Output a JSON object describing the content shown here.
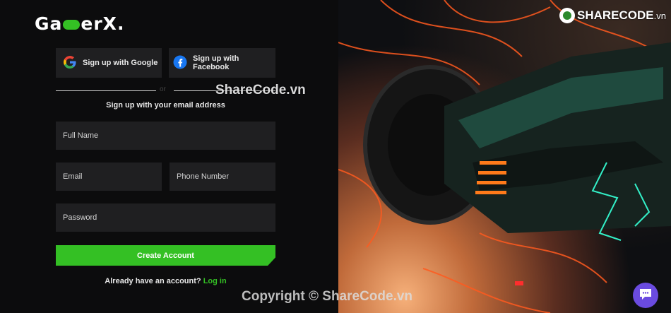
{
  "brand": {
    "logo_part1": "Ga",
    "logo_part2": "erX.",
    "logo_icon": "gamepad-icon"
  },
  "social": {
    "google_label": "Sign up with Google",
    "google_icon": "google-icon",
    "facebook_label": "Sign up with Facebook",
    "facebook_icon": "facebook-icon"
  },
  "divider": {
    "or_label": "or"
  },
  "form": {
    "email_hint": "Sign up with your email address",
    "full_name_placeholder": "Full Name",
    "email_placeholder": "Email",
    "phone_placeholder": "Phone Number",
    "password_placeholder": "Password",
    "submit_label": "Create Account"
  },
  "login": {
    "prompt": "Already have an account?",
    "link": "Log in"
  },
  "watermarks": {
    "center": "ShareCode.vn",
    "copyright": "Copyright © ShareCode.vn",
    "corner_brand": "SHARECODE",
    "corner_suffix": ".vn"
  },
  "colors": {
    "accent": "#34c024",
    "panel": "#1f1f21",
    "background": "#0c0c0d",
    "chat": "#6a4be0"
  },
  "chat": {
    "icon": "chat-icon"
  }
}
